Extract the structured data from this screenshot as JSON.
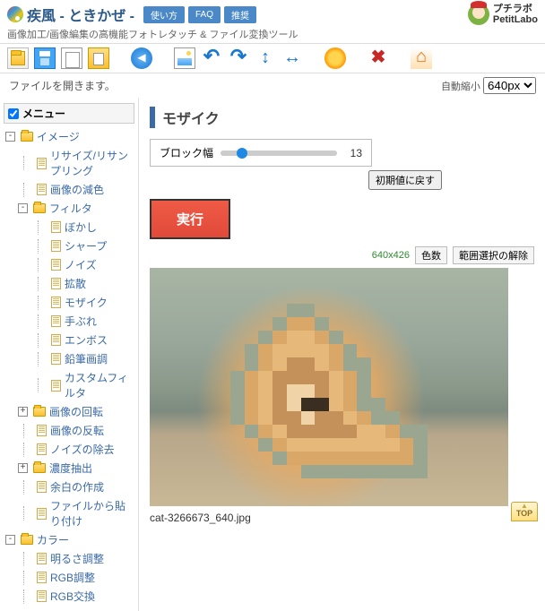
{
  "header": {
    "title": "疾風 - ときかぜ -",
    "buttons": [
      "使い方",
      "FAQ",
      "推奨"
    ],
    "subtitle": "画像加工/画像編集の高機能フォトレタッチ & ファイル変換ツール",
    "brand_top": "プチラボ",
    "brand_bottom": "PetitLabo"
  },
  "status_text": "ファイルを開きます。",
  "zoom": {
    "mode": "自動縮小",
    "options": [
      "640px"
    ]
  },
  "menu": {
    "header": "メニュー",
    "items": [
      {
        "lvl": 1,
        "type": "folder",
        "toggle": "-",
        "label": "イメージ"
      },
      {
        "lvl": 2,
        "type": "page",
        "label": "リサイズ/リサンプリング"
      },
      {
        "lvl": 2,
        "type": "page",
        "label": "画像の減色"
      },
      {
        "lvl": 2,
        "type": "folder",
        "toggle": "-",
        "label": "フィルタ"
      },
      {
        "lvl": 3,
        "type": "page",
        "label": "ぼかし"
      },
      {
        "lvl": 3,
        "type": "page",
        "label": "シャープ"
      },
      {
        "lvl": 3,
        "type": "page",
        "label": "ノイズ"
      },
      {
        "lvl": 3,
        "type": "page",
        "label": "拡散"
      },
      {
        "lvl": 3,
        "type": "page",
        "label": "モザイク"
      },
      {
        "lvl": 3,
        "type": "page",
        "label": "手ぶれ"
      },
      {
        "lvl": 3,
        "type": "page",
        "label": "エンボス"
      },
      {
        "lvl": 3,
        "type": "page",
        "label": "鉛筆画調"
      },
      {
        "lvl": 3,
        "type": "page",
        "label": "カスタムフィルタ"
      },
      {
        "lvl": 2,
        "type": "folder",
        "toggle": "+",
        "label": "画像の回転"
      },
      {
        "lvl": 2,
        "type": "page",
        "label": "画像の反転"
      },
      {
        "lvl": 2,
        "type": "page",
        "label": "ノイズの除去"
      },
      {
        "lvl": 2,
        "type": "folder",
        "toggle": "+",
        "label": "濃度抽出"
      },
      {
        "lvl": 2,
        "type": "page",
        "label": "余白の作成"
      },
      {
        "lvl": 2,
        "type": "page",
        "label": "ファイルから貼り付け"
      },
      {
        "lvl": 1,
        "type": "folder",
        "toggle": "-",
        "label": "カラー"
      },
      {
        "lvl": 2,
        "type": "page",
        "label": "明るさ調整"
      },
      {
        "lvl": 2,
        "type": "page",
        "label": "RGB調整"
      },
      {
        "lvl": 2,
        "type": "page",
        "label": "RGB交換"
      }
    ]
  },
  "panel": {
    "title": "モザイク",
    "param_label": "ブロック幅",
    "param_value": "13",
    "reset_label": "初期値に戻す",
    "exec_label": "実行",
    "dimensions": "640x426",
    "colors_btn": "色数",
    "deselect_btn": "範囲選択の解除",
    "filename": "cat-3266673_640.jpg"
  },
  "top_label": "TOP"
}
